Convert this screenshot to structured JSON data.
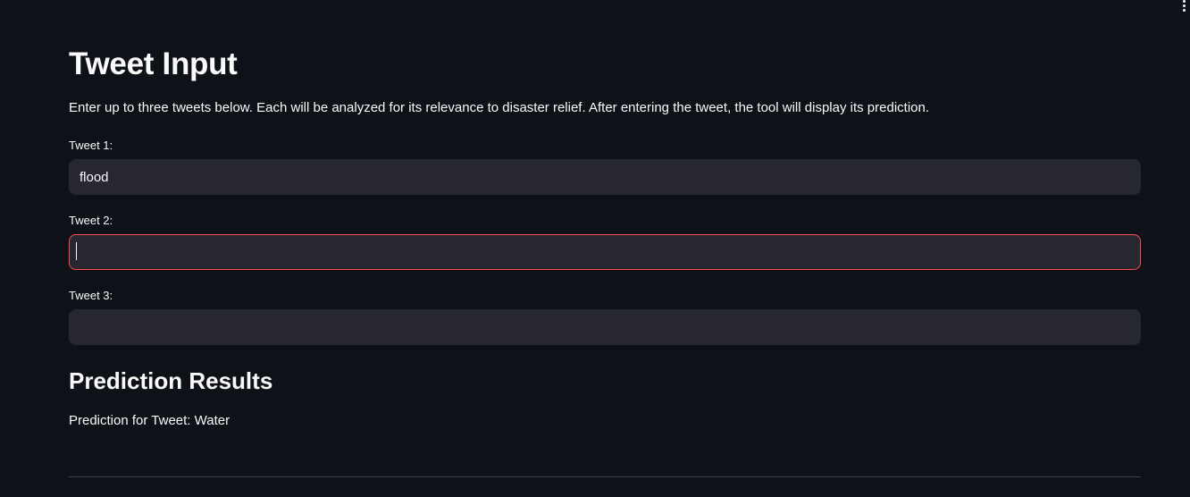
{
  "header": {
    "title": "Tweet Input",
    "description": "Enter up to three tweets below. Each will be analyzed for its relevance to disaster relief. After entering the tweet, the tool will display its prediction."
  },
  "inputs": [
    {
      "label": "Tweet 1:",
      "value": "flood",
      "placeholder": ""
    },
    {
      "label": "Tweet 2:",
      "value": "",
      "placeholder": ""
    },
    {
      "label": "Tweet 3:",
      "value": "",
      "placeholder": ""
    }
  ],
  "results": {
    "title": "Prediction Results",
    "line": "Prediction for Tweet: Water"
  },
  "theme": {
    "background": "#0e1117",
    "input_background": "#262730",
    "focus_border": "#ff4b4b",
    "text": "#fafafa"
  },
  "icons": {
    "menu": "kebab-menu-icon"
  }
}
